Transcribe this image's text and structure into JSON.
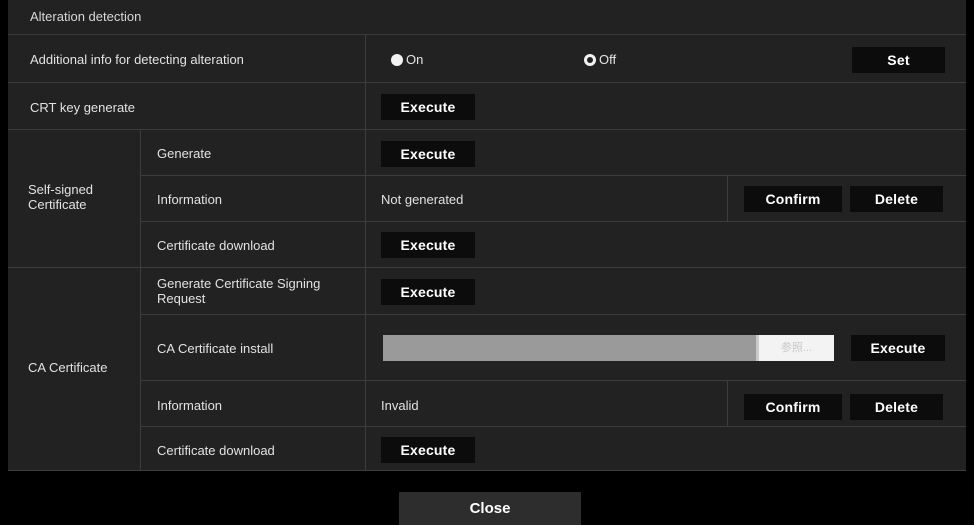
{
  "title": "Alteration detection",
  "additional_info": {
    "label": "Additional info for detecting alteration",
    "options": [
      "On",
      "Off"
    ],
    "selected": "Off",
    "set_label": "Set"
  },
  "crt_key": {
    "label": "CRT key generate",
    "execute_label": "Execute"
  },
  "self_signed": {
    "group_label": "Self-signed Certificate",
    "generate_label": "Generate",
    "generate_execute": "Execute",
    "information_label": "Information",
    "information_value": "Not generated",
    "confirm_label": "Confirm",
    "delete_label": "Delete",
    "download_label": "Certificate download",
    "download_execute": "Execute"
  },
  "ca_certificate": {
    "group_label": "CA Certificate",
    "csr_label": "Generate Certificate Signing Request",
    "csr_execute": "Execute",
    "install_label": "CA Certificate install",
    "browse_label": "参照...",
    "install_execute": "Execute",
    "information_label": "Information",
    "information_value": "Invalid",
    "confirm_label": "Confirm",
    "delete_label": "Delete",
    "download_label": "Certificate download",
    "download_execute": "Execute"
  },
  "close_label": "Close",
  "colors": {
    "background": "#000000",
    "panel": "#222222",
    "divider": "#3d3d3d",
    "button": "#0c0c0c",
    "close_button": "#2d2d2d"
  }
}
